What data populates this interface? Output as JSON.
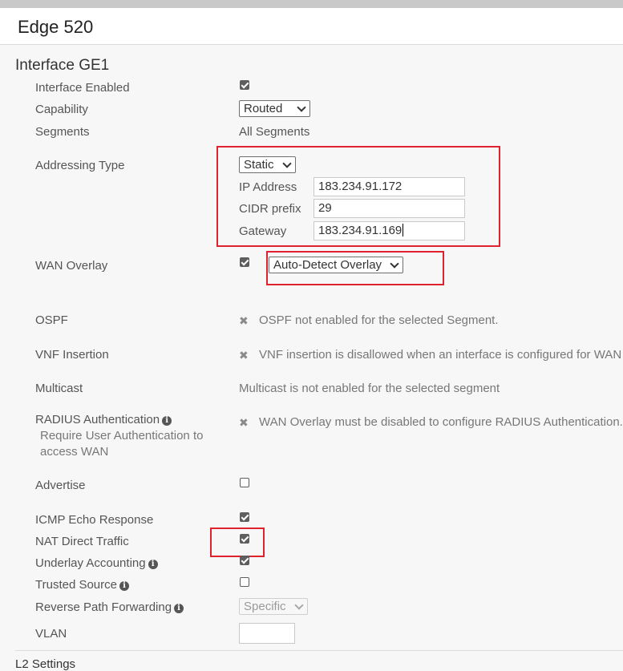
{
  "header": {
    "title": "Edge 520"
  },
  "section": {
    "title": "Interface GE1"
  },
  "rows": {
    "interface_enabled": {
      "label": "Interface Enabled"
    },
    "capability": {
      "label": "Capability",
      "value": "Routed"
    },
    "segments": {
      "label": "Segments",
      "value": "All Segments"
    },
    "addressing": {
      "label": "Addressing Type",
      "type": "Static",
      "ip_label": "IP Address",
      "ip_value": "183.234.91.172",
      "cidr_label": "CIDR prefix",
      "cidr_value": "29",
      "gateway_label": "Gateway",
      "gateway_value": "183.234.91.169"
    },
    "wan_overlay": {
      "label": "WAN Overlay",
      "value": "Auto-Detect Overlay"
    },
    "ospf": {
      "label": "OSPF",
      "note": "OSPF not enabled for the selected Segment."
    },
    "vnf": {
      "label": "VNF Insertion",
      "note": "VNF insertion is disallowed when an interface is configured for WAN"
    },
    "multicast": {
      "label": "Multicast",
      "note": "Multicast is not enabled for the selected segment"
    },
    "radius": {
      "label": "RADIUS Authentication",
      "sublabel": "Require User Authentication to access WAN",
      "note": "WAN Overlay must be disabled to configure RADIUS Authentication."
    },
    "advertise": {
      "label": "Advertise"
    },
    "icmp": {
      "label": "ICMP Echo Response"
    },
    "nat_direct": {
      "label": "NAT Direct Traffic"
    },
    "underlay": {
      "label": "Underlay Accounting"
    },
    "trusted": {
      "label": "Trusted Source"
    },
    "rpf": {
      "label": "Reverse Path Forwarding",
      "value": "Specific"
    },
    "vlan": {
      "label": "VLAN",
      "value": ""
    }
  },
  "l2": {
    "title": "L2 Settings"
  },
  "icons": {
    "info": "info-icon",
    "disabled": "x-icon"
  },
  "colors": {
    "highlight": "#e0222e",
    "checkbox": "#5e5e5e"
  }
}
